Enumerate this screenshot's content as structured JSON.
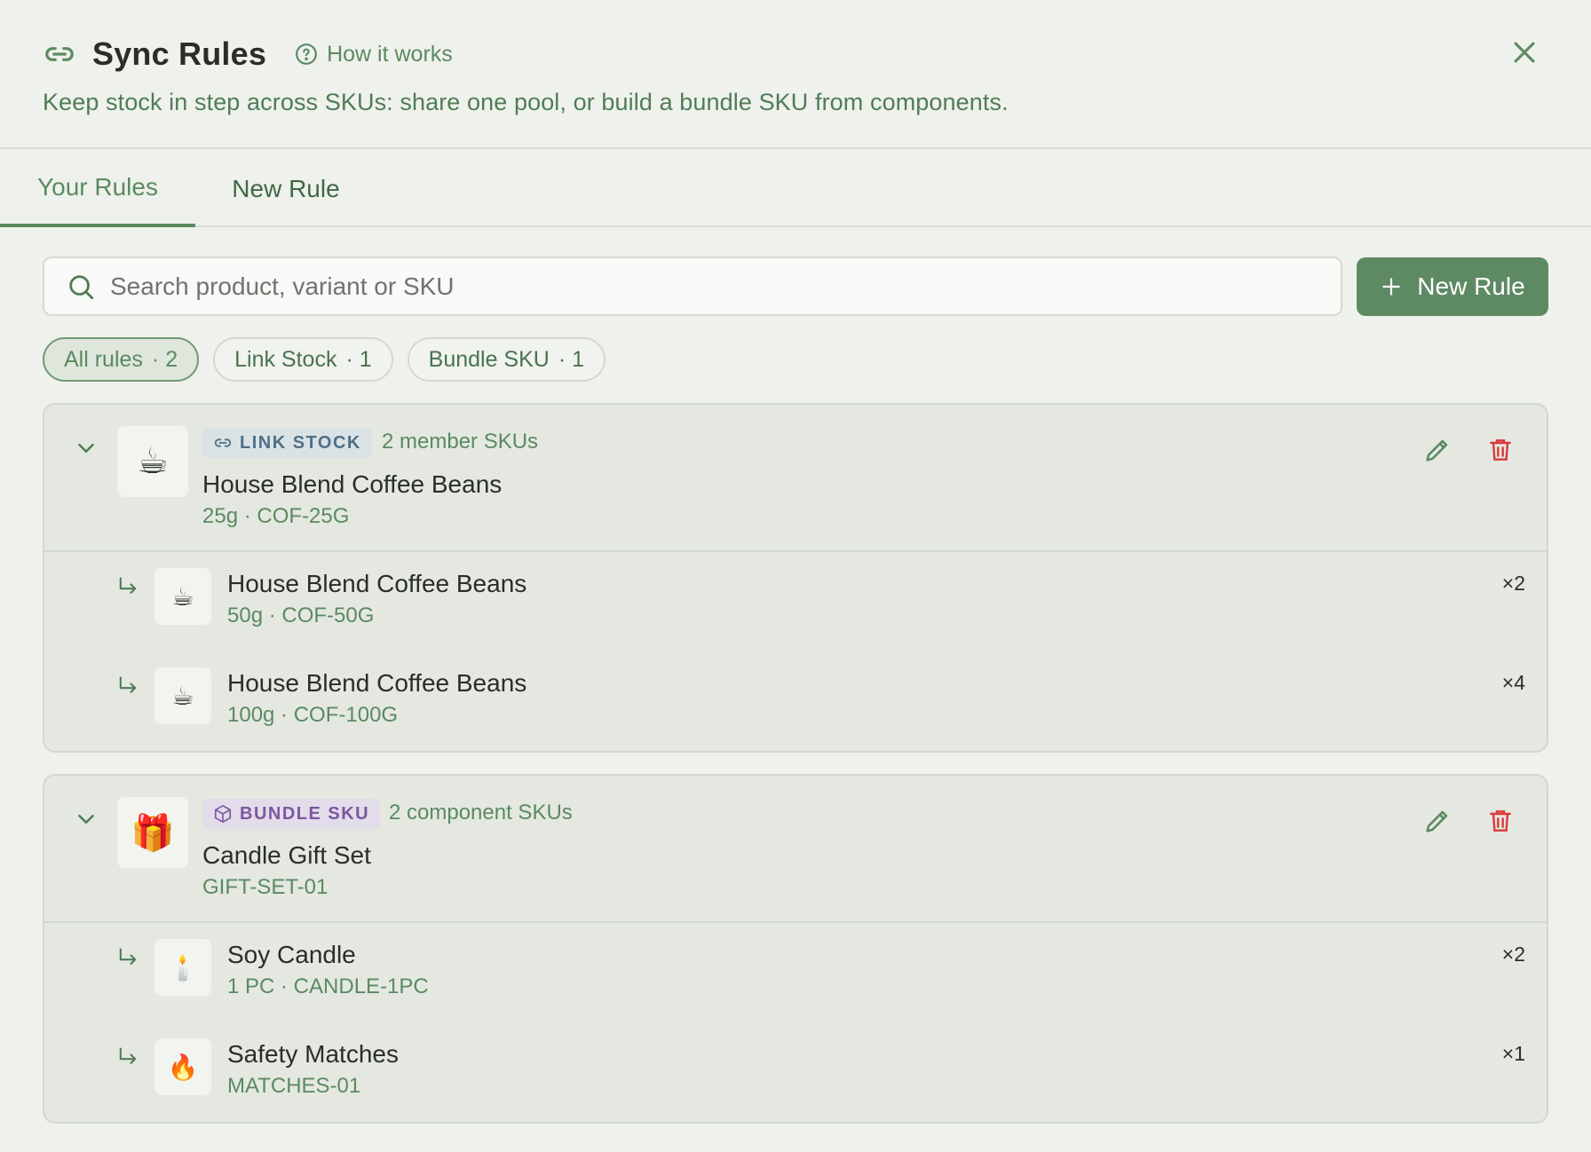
{
  "header": {
    "title": "Sync Rules",
    "how_it_works": "How it works",
    "subtitle": "Keep stock in step across SKUs: share one pool, or build a bundle SKU from components."
  },
  "tabs": [
    {
      "label": "Your Rules",
      "active": true
    },
    {
      "label": "New Rule",
      "active": false
    }
  ],
  "search": {
    "placeholder": "Search product, variant or SKU",
    "value": ""
  },
  "new_rule_button": "New Rule",
  "filters": [
    {
      "label": "All rules",
      "count": "· 2",
      "active": true
    },
    {
      "label": "Link Stock",
      "count": "· 1",
      "active": false
    },
    {
      "label": "Bundle SKU",
      "count": "· 1",
      "active": false
    }
  ],
  "rules": [
    {
      "type_badge": "LINK STOCK",
      "badge_icon": "link-icon",
      "meta": "2 member SKUs",
      "thumb": "☕",
      "name": "House Blend Coffee Beans",
      "sku": "25g · COF-25G",
      "items": [
        {
          "thumb": "☕",
          "name": "House Blend Coffee Beans",
          "sku": "50g · COF-50G",
          "qty": "×2"
        },
        {
          "thumb": "☕",
          "name": "House Blend Coffee Beans",
          "sku": "100g · COF-100G",
          "qty": "×4"
        }
      ]
    },
    {
      "type_badge": "BUNDLE SKU",
      "badge_icon": "box-icon",
      "meta": "2 component SKUs",
      "thumb": "🎁",
      "name": "Candle Gift Set",
      "sku": "GIFT-SET-01",
      "items": [
        {
          "thumb": "🕯️",
          "name": "Soy Candle",
          "sku": "1 PC · CANDLE-1PC",
          "qty": "×2"
        },
        {
          "thumb": "🔥",
          "name": "Safety Matches",
          "sku": "MATCHES-01",
          "qty": "×1"
        }
      ]
    }
  ],
  "colors": {
    "accent": "#5e8a63",
    "background": "#eff1ec",
    "card": "#e4e8e1",
    "delete": "#d93a3a",
    "link_badge": "#4f6f86",
    "bundle_badge": "#7a58a0"
  }
}
